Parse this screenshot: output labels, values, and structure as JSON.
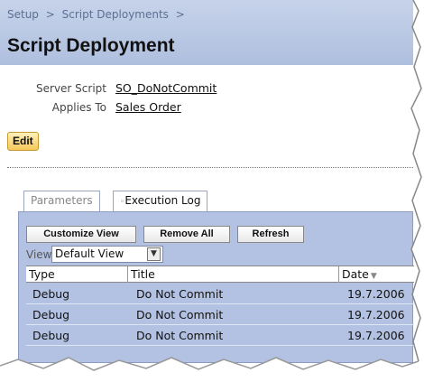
{
  "breadcrumb": [
    "Setup",
    ">",
    "Script Deployments",
    ">"
  ],
  "page_title": "Script Deployment",
  "fields": [
    {
      "label": "Server Script",
      "value": "SO_DoNotCommit"
    },
    {
      "label": "Applies To",
      "value": "Sales Order"
    }
  ],
  "edit_label": "Edit",
  "tabs": [
    {
      "label": "Parameters",
      "active": false
    },
    {
      "label": "Execution Log",
      "active": true
    }
  ],
  "toolbar": {
    "customize_view": "Customize View",
    "remove_all": "Remove All",
    "refresh": "Refresh"
  },
  "view": {
    "label": "View",
    "selected": "Default View"
  },
  "grid": {
    "columns": [
      "Type",
      "Title",
      "Date"
    ],
    "rows": [
      [
        "Debug",
        "Do Not Commit",
        "19.7.2006"
      ],
      [
        "Debug",
        "Do Not Commit",
        "19.7.2006"
      ],
      [
        "Debug",
        "Do Not Commit",
        "19.7.2006"
      ]
    ]
  },
  "colors": {
    "header_bg": "#b6c5e2",
    "panel_bg": "#b3c2e2",
    "edit_button": "#f5c85b"
  }
}
